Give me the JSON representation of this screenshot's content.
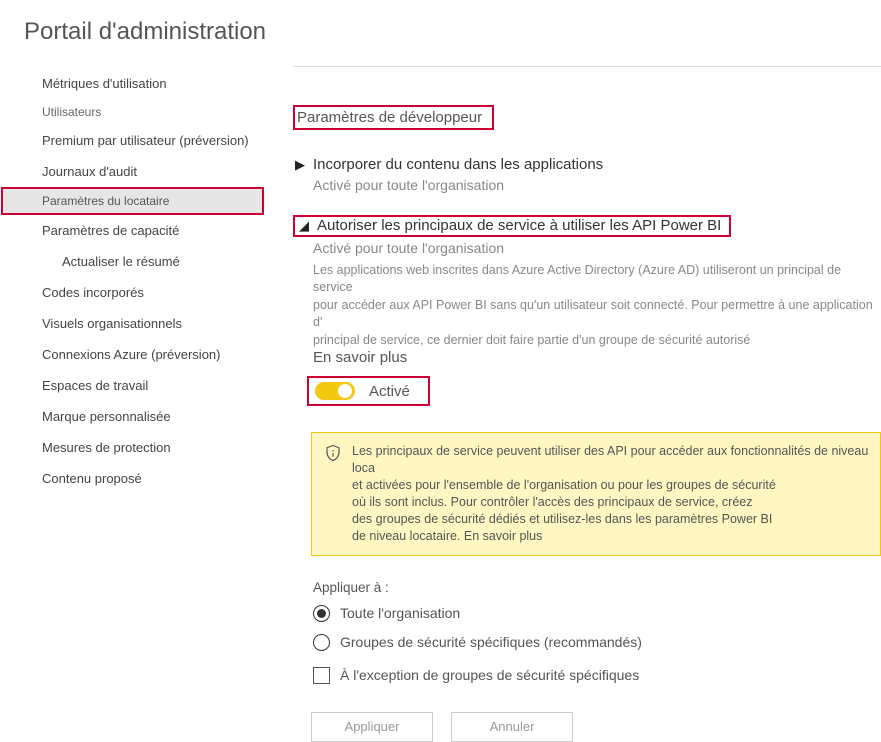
{
  "pageTitle": "Portail d'administration",
  "sidebar": {
    "items": [
      "Métriques d'utilisation",
      "Utilisateurs",
      "Premium par utilisateur (préversion)",
      "Journaux d'audit",
      "Paramètres du locataire",
      "Paramètres de capacité",
      "Actualiser le résumé",
      "Codes incorporés",
      "Visuels organisationnels",
      "Connexions Azure (préversion)",
      "Espaces de travail",
      "Marque personnalisée",
      "Mesures de protection",
      "Contenu proposé"
    ]
  },
  "content": {
    "sectionHeader": "Paramètres de développeur",
    "setting1": {
      "title": "Incorporer du contenu dans les applications",
      "status": "Activé pour toute l'organisation"
    },
    "setting2": {
      "title": "Autoriser les principaux de service à utiliser les API Power BI",
      "status": "Activé pour toute l'organisation",
      "descLine1": "Les applications web inscrites dans Azure Active Directory (Azure AD) utiliseront un principal de service",
      "descLine2": "pour accéder aux API Power BI sans qu'un utilisateur soit connecté. Pour permettre à une application d'",
      "descLine3": "principal de service, ce dernier doit faire partie d'un groupe de sécurité autorisé",
      "learnMore": "En savoir plus",
      "toggleLabel": "Activé",
      "infoLine1": "Les principaux de service peuvent utiliser des API pour accéder aux fonctionnalités de niveau loca",
      "infoLine2": "et activées pour l'ensemble de l'organisation ou pour les groupes de sécurité",
      "infoLine3": "où ils sont inclus. Pour contrôler l'accès des principaux de service, créez",
      "infoLine4": " des groupes de sécurité dédiés et utilisez-les dans les paramètres Power BI",
      "infoLine5": "de niveau locataire. En savoir plus",
      "applyLabel": "Appliquer à :",
      "radio1": "Toute l'organisation",
      "radio2": "Groupes de sécurité spécifiques (recommandés)",
      "check1": "À l'exception de groupes de sécurité spécifiques",
      "btnApply": "Appliquer",
      "btnCancel": "Annuler"
    }
  }
}
